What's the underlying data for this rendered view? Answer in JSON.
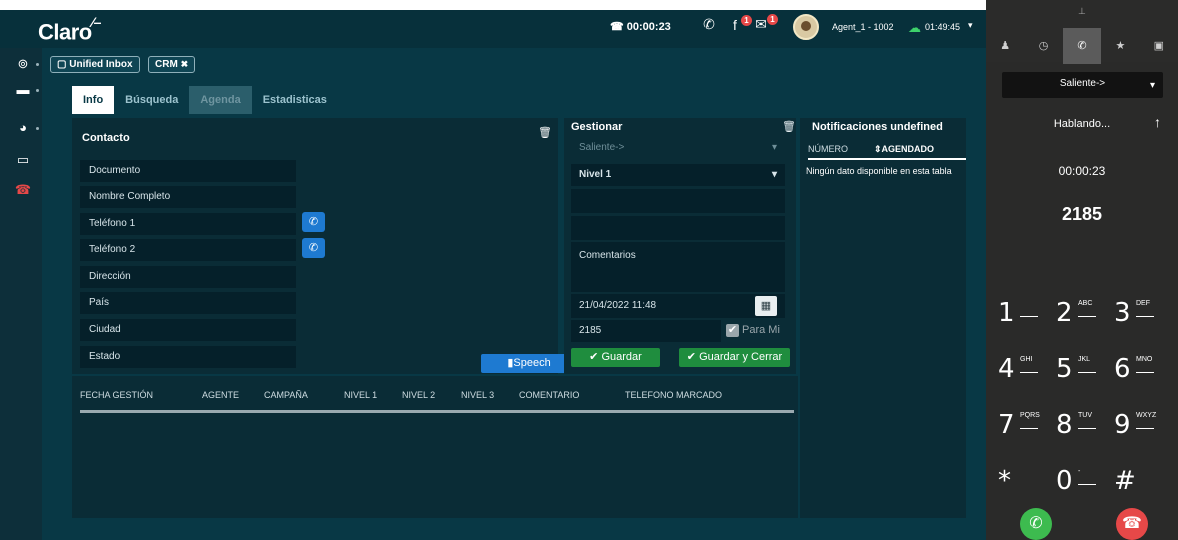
{
  "header": {
    "logo": "Claro",
    "call_timer": "00:00:23",
    "facebook_badge": "1",
    "mail_badge": "1",
    "agent_name": "Agent_1 - 1002",
    "agent_time": "01:49:45"
  },
  "rail": {
    "items": [
      "gamepad-icon",
      "laptop-icon",
      "pie-chart-icon",
      "monitor-icon",
      "hangup-icon"
    ]
  },
  "tags": {
    "unified_inbox": "Unified Inbox",
    "crm": "CRM"
  },
  "tabs": [
    {
      "label": "Info"
    },
    {
      "label": "Búsqueda"
    },
    {
      "label": "Agenda"
    },
    {
      "label": "Estadisticas"
    }
  ],
  "contacto": {
    "title": "Contacto",
    "fields": [
      {
        "label": "Documento"
      },
      {
        "label": "Nombre Completo"
      },
      {
        "label": "Teléfono 1"
      },
      {
        "label": "Teléfono 2"
      },
      {
        "label": "Dirección"
      },
      {
        "label": "País"
      },
      {
        "label": "Ciudad"
      },
      {
        "label": "Estado"
      }
    ],
    "speech_label": "Speech"
  },
  "gestionar": {
    "title": "Gestionar",
    "direction": "Saliente->",
    "level": "Nivel 1",
    "comments_placeholder": "Comentarios",
    "date": "21/04/2022 11:48",
    "phone": "2185",
    "para_mi": "Para Mi",
    "save_label": "Guardar",
    "save_close_label": "Guardar y Cerrar"
  },
  "notifications": {
    "title": "Notificaciones",
    "title_suffix": "undefined",
    "col_numero": "NÚMERO",
    "col_agendado": "AGENDADO",
    "empty": "Ningún dato disponible en esta tabla"
  },
  "history_table": {
    "columns": [
      "FECHA GESTIÓN",
      "AGENTE",
      "CAMPAÑA",
      "NIVEL 1",
      "NIVEL 2",
      "NIVEL 3",
      "COMENTARIO",
      "TELEFONO MARCADO"
    ]
  },
  "softphone": {
    "direction": "Saliente->",
    "status": "Hablando...",
    "timer": "00:00:23",
    "number": "2185",
    "keys": [
      {
        "num": "1",
        "letters": ""
      },
      {
        "num": "2",
        "letters": "ABC"
      },
      {
        "num": "3",
        "letters": "DEF"
      },
      {
        "num": "4",
        "letters": "GHI"
      },
      {
        "num": "5",
        "letters": "JKL"
      },
      {
        "num": "6",
        "letters": "MNO"
      },
      {
        "num": "7",
        "letters": "PQRS"
      },
      {
        "num": "8",
        "letters": "TUV"
      },
      {
        "num": "9",
        "letters": "WXYZ"
      },
      {
        "num": "*",
        "letters": ""
      },
      {
        "num": "0",
        "letters": "-"
      },
      {
        "num": "#",
        "letters": ""
      }
    ]
  }
}
